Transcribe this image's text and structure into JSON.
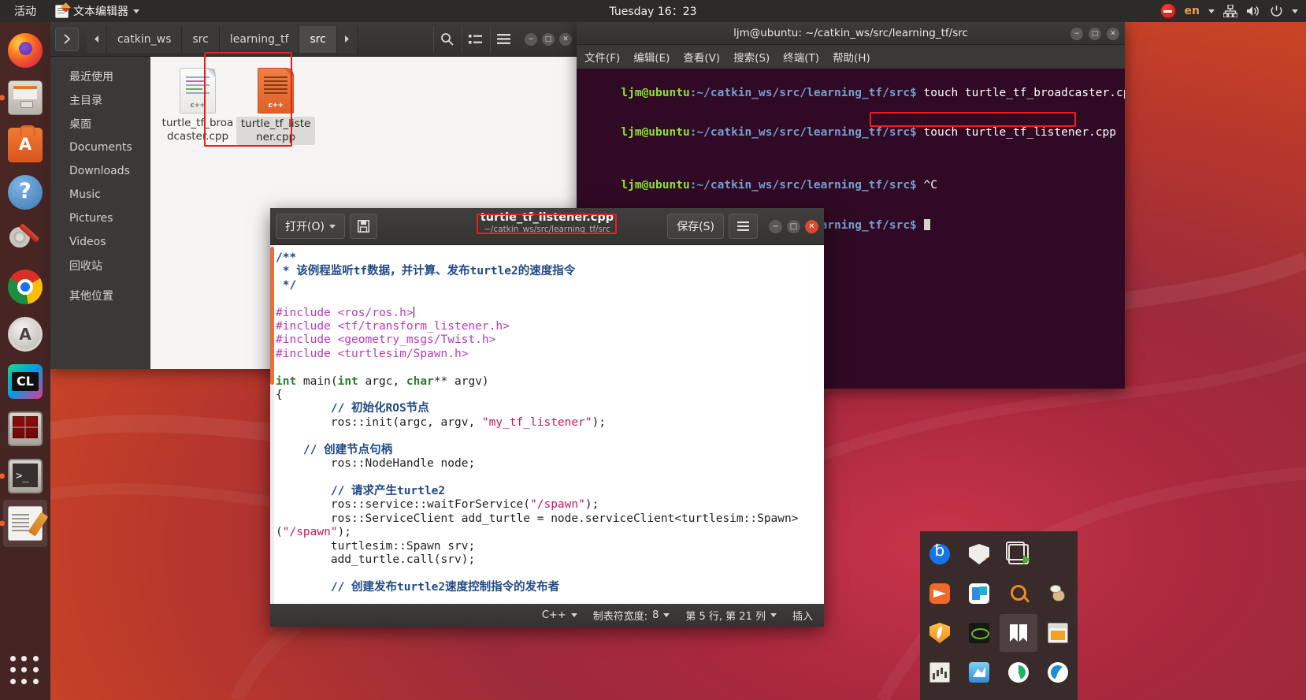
{
  "topbar": {
    "activities": "活动",
    "app_icon": "text-editor-icon",
    "app_name": "文本编辑器",
    "clock": "Tuesday 16：23",
    "dnd_icon": "do-not-disturb-icon",
    "language": "en",
    "network_icon": "network-icon",
    "volume_icon": "volume-icon",
    "power_icon": "power-icon"
  },
  "launcher": {
    "items": [
      {
        "name": "firefox",
        "label": "Firefox",
        "active": false
      },
      {
        "name": "files",
        "label": "Files",
        "active": false,
        "running": true
      },
      {
        "name": "ubuntu-software",
        "label": "Ubuntu Software",
        "active": false
      },
      {
        "name": "help",
        "label": "Help",
        "active": false
      },
      {
        "name": "settings",
        "label": "System Settings",
        "active": false
      },
      {
        "name": "chrome",
        "label": "Google Chrome",
        "active": false
      },
      {
        "name": "software-updater",
        "label": "Software Updater",
        "active": false
      },
      {
        "name": "clion",
        "label": "CLion",
        "active": false
      },
      {
        "name": "terminator",
        "label": "Terminator",
        "active": false
      },
      {
        "name": "terminal",
        "label": "Terminal",
        "active": false,
        "running": true
      },
      {
        "name": "text-editor",
        "label": "Text Editor",
        "active": true,
        "running": true
      }
    ],
    "show_apps": "Show Applications"
  },
  "filemanager": {
    "breadcrumbs": [
      "catkin_ws",
      "src",
      "learning_tf",
      "src"
    ],
    "current_crumb": "src",
    "back_icon": "chevron-left-icon",
    "forward_icon": "chevron-right-icon",
    "expand_icon": "chevron-right-icon",
    "search_icon": "search-icon",
    "list_view_icon": "list-view-icon",
    "menu_icon": "hamburger-menu-icon",
    "sidebar": [
      "最近使用",
      "主目录",
      "桌面",
      "Documents",
      "Downloads",
      "Music",
      "Pictures",
      "Videos",
      "回收站",
      "其他位置"
    ],
    "files": [
      {
        "name": "turtle_tf_broadcaster.cpp",
        "type": "c++",
        "selected": false
      },
      {
        "name": "turtle_tf_listener.cpp",
        "type": "c++",
        "selected": true
      }
    ],
    "window_buttons": {
      "minimize": "−",
      "maximize": "□",
      "close": "✕"
    }
  },
  "terminal": {
    "title": "ljm@ubuntu: ~/catkin_ws/src/learning_tf/src",
    "menu": [
      "文件(F)",
      "编辑(E)",
      "查看(V)",
      "搜索(S)",
      "终端(T)",
      "帮助(H)"
    ],
    "prompt_user": "ljm@ubuntu",
    "prompt_path": ":~/catkin_ws/src/learning_tf/src$",
    "lines": [
      {
        "command": "touch turtle_tf_broadcaster.cpp",
        "highlight": false
      },
      {
        "command": "touch turtle_tf_listener.cpp",
        "highlight": true
      },
      {
        "command": "^C",
        "highlight": false
      },
      {
        "command": "",
        "highlight": false,
        "cursor": true
      }
    ],
    "window_buttons": {
      "minimize": "−",
      "maximize": "□",
      "close": "✕"
    }
  },
  "editor": {
    "open_button": "打开(O)",
    "saveas_icon": "save-as-icon",
    "title": "turtle_tf_listener.cpp",
    "subtitle": "~/catkin_ws/src/learning_tf/src",
    "save_button": "保存(S)",
    "menu_icon": "hamburger-menu-icon",
    "window_buttons": {
      "minimize": "−",
      "maximize": "□",
      "close": "✕"
    },
    "status": {
      "language": "C++",
      "tab_width_label": "制表符宽度:",
      "tab_width_value": "8",
      "cursor_position": "第 5 行, 第 21 列",
      "insert_mode": "插入",
      "dropdown_icon": "chevron-down-icon"
    },
    "code_lines": [
      [
        {
          "t": "/**",
          "c": "cmt"
        }
      ],
      [
        {
          "t": " * 该例程监听tf数据，并计算、发布turtle2的速度指令",
          "c": "cmt"
        }
      ],
      [
        {
          "t": " */",
          "c": "cmt"
        }
      ],
      [
        {
          "t": "",
          "c": "pln"
        }
      ],
      [
        {
          "t": "#include <ros/ros.h>",
          "c": "pre"
        },
        {
          "t": "CARET",
          "c": "caret"
        }
      ],
      [
        {
          "t": "#include <tf/transform_listener.h>",
          "c": "pre"
        }
      ],
      [
        {
          "t": "#include <geometry_msgs/Twist.h>",
          "c": "pre"
        }
      ],
      [
        {
          "t": "#include <turtlesim/Spawn.h>",
          "c": "pre"
        }
      ],
      [
        {
          "t": "",
          "c": "pln"
        }
      ],
      [
        {
          "t": "int",
          "c": "kw"
        },
        {
          "t": " main(",
          "c": "pln"
        },
        {
          "t": "int",
          "c": "kw"
        },
        {
          "t": " argc, ",
          "c": "pln"
        },
        {
          "t": "char",
          "c": "kw"
        },
        {
          "t": "** argv)",
          "c": "pln"
        }
      ],
      [
        {
          "t": "{",
          "c": "pln"
        }
      ],
      [
        {
          "t": "        // 初始化ROS节点",
          "c": "cmt"
        }
      ],
      [
        {
          "t": "        ros::init(argc, argv, ",
          "c": "pln"
        },
        {
          "t": "\"my_tf_listener\"",
          "c": "str"
        },
        {
          "t": ");",
          "c": "pln"
        }
      ],
      [
        {
          "t": "",
          "c": "pln"
        }
      ],
      [
        {
          "t": "    // 创建节点句柄",
          "c": "cmt"
        }
      ],
      [
        {
          "t": "        ros::NodeHandle node;",
          "c": "pln"
        }
      ],
      [
        {
          "t": "",
          "c": "pln"
        }
      ],
      [
        {
          "t": "        // 请求产生turtle2",
          "c": "cmt"
        }
      ],
      [
        {
          "t": "        ros::service::waitForService(",
          "c": "pln"
        },
        {
          "t": "\"/spawn\"",
          "c": "str"
        },
        {
          "t": ");",
          "c": "pln"
        }
      ],
      [
        {
          "t": "        ros::ServiceClient add_turtle = node.serviceClient<turtlesim::Spawn>(",
          "c": "pln"
        },
        {
          "t": "\"/spawn\"",
          "c": "str"
        },
        {
          "t": ");",
          "c": "pln"
        }
      ],
      [
        {
          "t": "        turtlesim::Spawn srv;",
          "c": "pln"
        }
      ],
      [
        {
          "t": "        add_turtle.call(srv);",
          "c": "pln"
        }
      ],
      [
        {
          "t": "",
          "c": "pln"
        }
      ],
      [
        {
          "t": "        // 创建发布turtle2速度控制指令的发布者",
          "c": "cmt"
        }
      ]
    ]
  },
  "tray_panel": {
    "icons": [
      {
        "name": "bluetooth-icon",
        "active": false
      },
      {
        "name": "security-shield-warning-icon",
        "active": false
      },
      {
        "name": "screen-share-icon",
        "active": false
      },
      {
        "name": "",
        "active": false
      },
      {
        "name": "mail-icon",
        "active": false
      },
      {
        "name": "teams-icon",
        "active": false
      },
      {
        "name": "search-icon",
        "active": false
      },
      {
        "name": "bug-icon",
        "active": false
      },
      {
        "name": "firewall-shield-icon",
        "active": false
      },
      {
        "name": "nvidia-icon",
        "active": false
      },
      {
        "name": "bookmark-icon",
        "active": true
      },
      {
        "name": "window-icon",
        "active": false
      },
      {
        "name": "audio-mixer-icon",
        "active": false
      },
      {
        "name": "image-viewer-icon",
        "active": false
      },
      {
        "name": "recycle-icon",
        "active": false
      },
      {
        "name": "browser-icon",
        "active": false
      }
    ]
  },
  "annotations": {
    "accent_color": "#ef1c1c",
    "boxes": [
      "file-listener-selected",
      "terminal-touch-command",
      "editor-title"
    ]
  }
}
